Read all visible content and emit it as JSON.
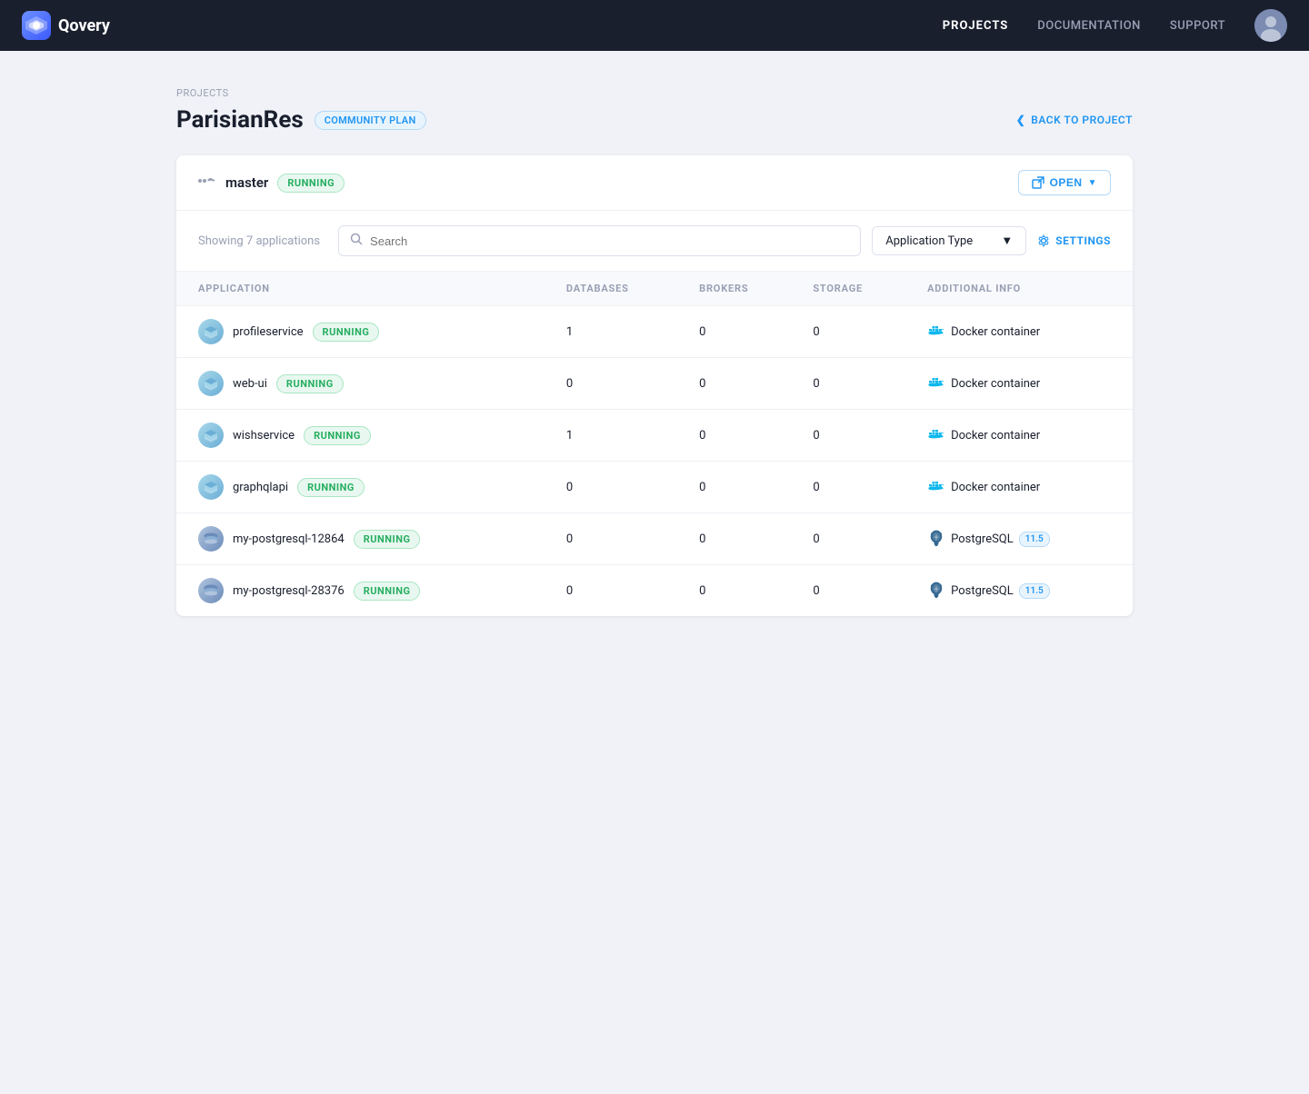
{
  "brand": {
    "name": "Qovery",
    "logo_alt": "Qovery logo"
  },
  "navbar": {
    "links": [
      {
        "label": "PROJECTS",
        "active": true
      },
      {
        "label": "DOCUMENTATION",
        "active": false
      },
      {
        "label": "SUPPORT",
        "active": false
      }
    ]
  },
  "breadcrumb": "PROJECTS",
  "page": {
    "title": "ParisianRes",
    "plan_badge": "COMMUNITY PLAN",
    "back_button": "BACK TO PROJECT"
  },
  "environment": {
    "name": "master",
    "status": "RUNNING",
    "open_button": "OPEN"
  },
  "toolbar": {
    "showing_text": "Showing 7 applications",
    "search_placeholder": "Search",
    "type_dropdown_label": "Application Type",
    "settings_label": "SETTINGS"
  },
  "table": {
    "columns": [
      "APPLICATION",
      "DATABASES",
      "BROKERS",
      "STORAGE",
      "ADDITIONAL INFO"
    ],
    "rows": [
      {
        "name": "profileservice",
        "type": "app",
        "status": "RUNNING",
        "databases": "1",
        "brokers": "0",
        "storage": "0",
        "additional_info": "Docker container",
        "additional_type": "docker"
      },
      {
        "name": "web-ui",
        "type": "app",
        "status": "RUNNING",
        "databases": "0",
        "brokers": "0",
        "storage": "0",
        "additional_info": "Docker container",
        "additional_type": "docker"
      },
      {
        "name": "wishservice",
        "type": "app",
        "status": "RUNNING",
        "databases": "1",
        "brokers": "0",
        "storage": "0",
        "additional_info": "Docker container",
        "additional_type": "docker"
      },
      {
        "name": "graphqlapi",
        "type": "app",
        "status": "RUNNING",
        "databases": "0",
        "brokers": "0",
        "storage": "0",
        "additional_info": "Docker container",
        "additional_type": "docker"
      },
      {
        "name": "my-postgresql-12864",
        "type": "db",
        "status": "RUNNING",
        "databases": "0",
        "brokers": "0",
        "storage": "0",
        "additional_info": "PostgreSQL",
        "additional_type": "postgres",
        "version": "11.5"
      },
      {
        "name": "my-postgresql-28376",
        "type": "db",
        "status": "RUNNING",
        "databases": "0",
        "brokers": "0",
        "storage": "0",
        "additional_info": "PostgreSQL",
        "additional_type": "postgres",
        "version": "11.5"
      }
    ]
  }
}
